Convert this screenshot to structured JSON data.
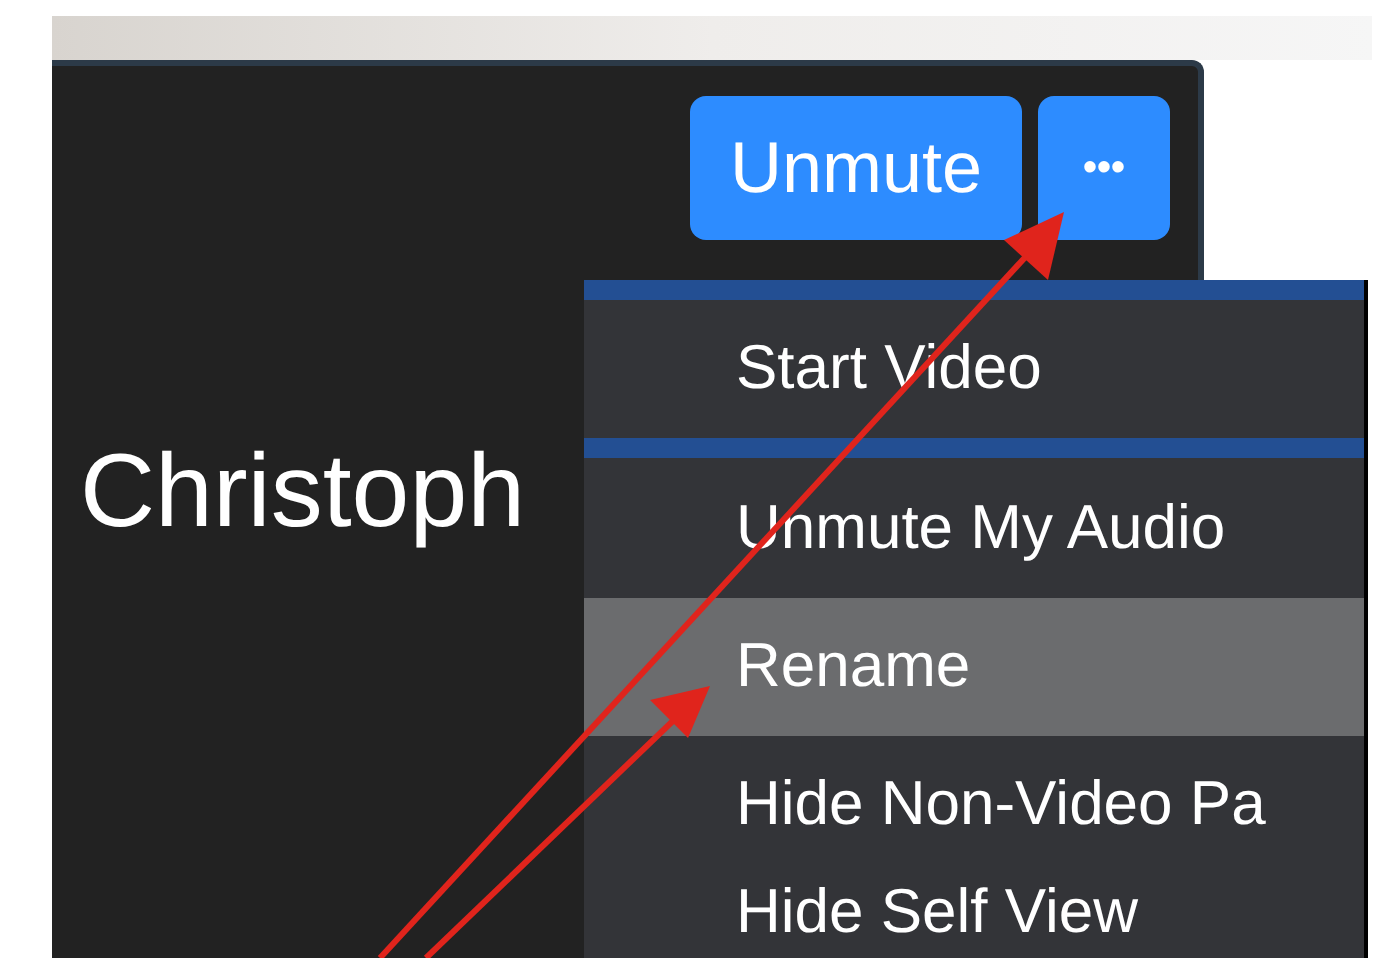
{
  "unmute_button": {
    "label": "Unmute"
  },
  "more_button": {
    "label": "•••"
  },
  "participant_name": "Christoph",
  "menu": {
    "items": [
      {
        "label": "Start Video",
        "focused": true,
        "hovered": false
      },
      {
        "label": "Unmute My Audio",
        "focused": false,
        "hovered": false
      },
      {
        "label": "Rename",
        "focused": false,
        "hovered": true
      },
      {
        "label": "Hide Non-Video Pa",
        "focused": false,
        "hovered": false
      },
      {
        "label": "Hide Self View",
        "focused": false,
        "hovered": false
      }
    ]
  }
}
